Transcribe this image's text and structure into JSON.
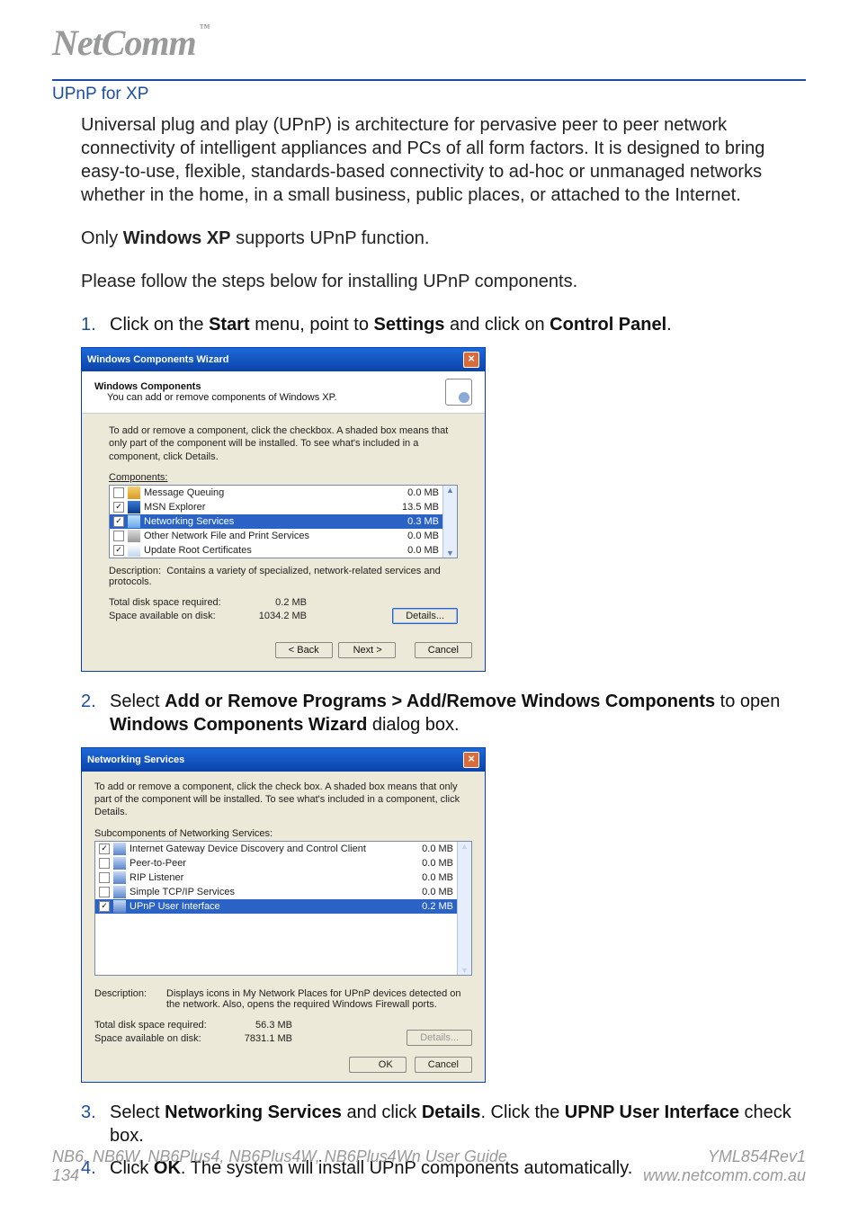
{
  "logo": {
    "text": "NetComm",
    "tm": "™"
  },
  "section_title": "UPnP for XP",
  "intro": "Universal plug and play (UPnP) is architecture for pervasive peer to peer network connectivity of intelligent appliances and PCs of all form factors. It is designed to bring easy-to-use, flexible, standards-based connectivity to ad-hoc or unmanaged networks whether in the home, in a small business, public places, or attached to the Internet.",
  "only_pre": "Only ",
  "only_bold": "Windows XP",
  "only_post": " supports UPnP function.",
  "follow": "Please follow the steps below for installing UPnP components.",
  "step1": {
    "num": "1.",
    "pre": "Click on the ",
    "b1": "Start",
    "m1": " menu, point to ",
    "b2": "Settings",
    "m2": " and click on ",
    "b3": "Control Panel",
    "post": "."
  },
  "wiz1": {
    "title": "Windows Components Wizard",
    "head_bold": "Windows Components",
    "head_sub": "You can add or remove components of Windows XP.",
    "instr": "To add or remove a component, click the checkbox. A shaded box means that only part of the component will be installed. To see what's included in a component, click Details.",
    "list_label": "Components:",
    "rows": [
      {
        "checked": false,
        "name": "Message Queuing",
        "size": "0.0 MB"
      },
      {
        "checked": true,
        "name": "MSN Explorer",
        "size": "13.5 MB"
      },
      {
        "checked": true,
        "name": "Networking Services",
        "size": "0.3 MB",
        "selected": true
      },
      {
        "checked": false,
        "name": "Other Network File and Print Services",
        "size": "0.0 MB"
      },
      {
        "checked": true,
        "name": "Update Root Certificates",
        "size": "0.0 MB"
      }
    ],
    "desc_label": "Description:",
    "desc_text": "Contains a variety of specialized, network-related services and protocols.",
    "req_lbl": "Total disk space required:",
    "req_val": "0.2 MB",
    "avail_lbl": "Space available on disk:",
    "avail_val": "1034.2 MB",
    "details": "Details...",
    "back": "< Back",
    "next": "Next >",
    "cancel": "Cancel"
  },
  "step2": {
    "num": "2.",
    "pre": "Select ",
    "b1": "Add or Remove Programs > Add/Remove Windows Components",
    "m1": " to open ",
    "b2": "Windows Components Wizard",
    "post": " dialog box."
  },
  "wiz2": {
    "title": "Networking Services",
    "instr": "To add or remove a component, click the check box. A shaded box means that only part of the component will be installed. To see what's included in a component, click Details.",
    "list_label": "Subcomponents of Networking Services:",
    "rows": [
      {
        "checked": true,
        "name": "Internet Gateway Device Discovery and Control Client",
        "size": "0.0 MB"
      },
      {
        "checked": false,
        "name": "Peer-to-Peer",
        "size": "0.0 MB"
      },
      {
        "checked": false,
        "name": "RIP Listener",
        "size": "0.0 MB"
      },
      {
        "checked": false,
        "name": "Simple TCP/IP Services",
        "size": "0.0 MB"
      },
      {
        "checked": true,
        "name": "UPnP User Interface",
        "size": "0.2 MB",
        "selected": true
      }
    ],
    "desc_label": "Description:",
    "desc_text": "Displays icons in My Network Places for UPnP devices detected on the network. Also, opens the required Windows Firewall ports.",
    "req_lbl": "Total disk space required:",
    "req_val": "56.3 MB",
    "avail_lbl": "Space available on disk:",
    "avail_val": "7831.1 MB",
    "details": "Details...",
    "ok": "OK",
    "cancel": "Cancel"
  },
  "step3": {
    "num": "3.",
    "pre": "Select ",
    "b1": "Networking Services",
    "m1": " and click ",
    "b2": "Details",
    "m2": ". Click the ",
    "b3": "UPNP User Interface",
    "post": " check box."
  },
  "step4": {
    "num": "4.",
    "pre": "Click ",
    "b1": "OK",
    "post": ". The system will install UPnP components automatically."
  },
  "footer": {
    "guide": "NB6, NB6W, NB6Plus4, NB6Plus4W, NB6Plus4Wn User Guide",
    "page": "134",
    "rev": "YML854Rev1",
    "url": "www.netcomm.com.au"
  }
}
